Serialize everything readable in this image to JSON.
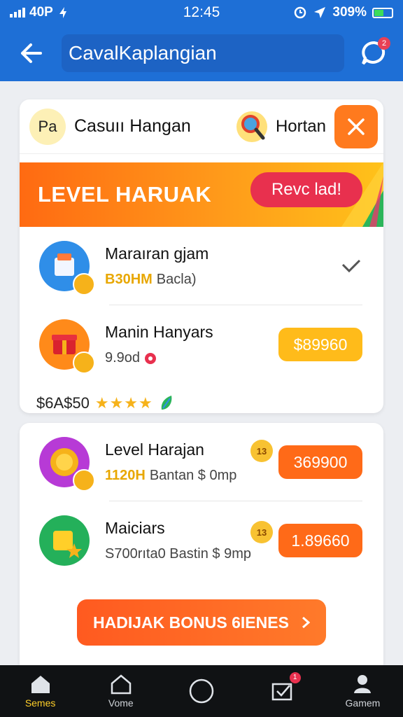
{
  "status_bar": {
    "network": "40P",
    "time": "12:45",
    "battery": "309%"
  },
  "app_bar": {
    "search_value": "CavalKaplangian",
    "chat_badge": "2"
  },
  "card1": {
    "chip_label": "Pa",
    "title": "Casuıı Hangan",
    "right_label": "Hortan",
    "banner": {
      "title": "LEVEL HARUAK",
      "button": "Revc lad!"
    },
    "items": [
      {
        "name": "Maraıran gjam",
        "sub_gold": "B30HM",
        "sub_text": "Bacla)",
        "color": "#2f8ee8"
      },
      {
        "name": "Manin Hanyars",
        "sub_text": "9.9od",
        "price": "$89960",
        "color": "#ff8a1a"
      }
    ],
    "rating_text": "$6A$50",
    "stars": "★★★★"
  },
  "card2": {
    "items": [
      {
        "name": "Level Harajan",
        "badge": "13",
        "sub_gold": "1120H",
        "sub_text": "Bantan $ 0mp",
        "price": "369900",
        "color": "#b73ad6"
      },
      {
        "name": "Maiciars",
        "badge": "13",
        "sub_text": "S700rıta0 Bastin $ 9mp",
        "price": "1.89660",
        "color": "#24b05a"
      }
    ],
    "bonus_button": "HADIJAK BONUS 6IENES"
  },
  "bottom_nav": [
    {
      "label": "Semes",
      "active": true
    },
    {
      "label": "Vome"
    },
    {
      "label": ""
    },
    {
      "label": "",
      "badge": "1"
    },
    {
      "label": "Gamem"
    }
  ],
  "colors": {
    "primary": "#1e6fd6",
    "accent": "#ff6a18",
    "gold": "#ffbb1a",
    "reward": "#e8304e"
  }
}
